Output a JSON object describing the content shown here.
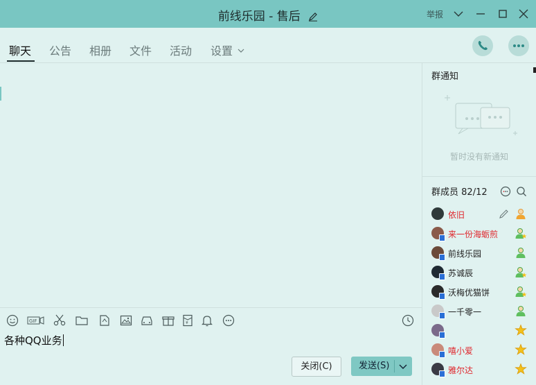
{
  "window": {
    "title": "前线乐园 - 售后",
    "report_label": "举报"
  },
  "tabs": [
    {
      "label": "聊天",
      "active": true
    },
    {
      "label": "公告"
    },
    {
      "label": "相册"
    },
    {
      "label": "文件"
    },
    {
      "label": "活动"
    },
    {
      "label": "设置"
    }
  ],
  "toolbar": {
    "icons": [
      "emoji-icon",
      "gif-icon",
      "scissors-icon",
      "folder-icon",
      "doc-icon",
      "image-icon",
      "car-icon",
      "gift-icon",
      "red-packet-icon",
      "bell-icon",
      "more-icon",
      "history-icon"
    ]
  },
  "input": {
    "value": "各种QQ业务"
  },
  "buttons": {
    "close": "关闭(C)",
    "send": "发送(S)"
  },
  "sidebar": {
    "notice_title": "群通知",
    "notice_empty": "暂时没有新通知",
    "members_title": "群成员",
    "members_count": "82/12",
    "members": [
      {
        "name": "依旧",
        "color": "#e0262c",
        "role": "owner-icon",
        "editable": true
      },
      {
        "name": "来一份海蛎煎",
        "color": "#e0262c",
        "role": "admin-star-icon"
      },
      {
        "name": "前线乐园",
        "color": "#222222",
        "role": "admin-icon"
      },
      {
        "name": "苏诚辰",
        "color": "#222222",
        "role": "admin-star-icon"
      },
      {
        "name": "沃梅优猫饼",
        "color": "#222222",
        "role": "admin-star-icon"
      },
      {
        "name": "一千零一",
        "color": "#222222",
        "role": "admin-icon"
      },
      {
        "name": "",
        "color": "#222222",
        "role": "star-icon"
      },
      {
        "name": "嘻小爱",
        "color": "#e0262c",
        "role": "star-icon"
      },
      {
        "name": "雅尔达",
        "color": "#e0262c",
        "role": "star-icon"
      }
    ]
  },
  "colors": {
    "titlebar": "#79c6c2",
    "background": "#e0f2f0",
    "send_button": "#7fc8c3",
    "highlight_name": "#e0262c"
  }
}
